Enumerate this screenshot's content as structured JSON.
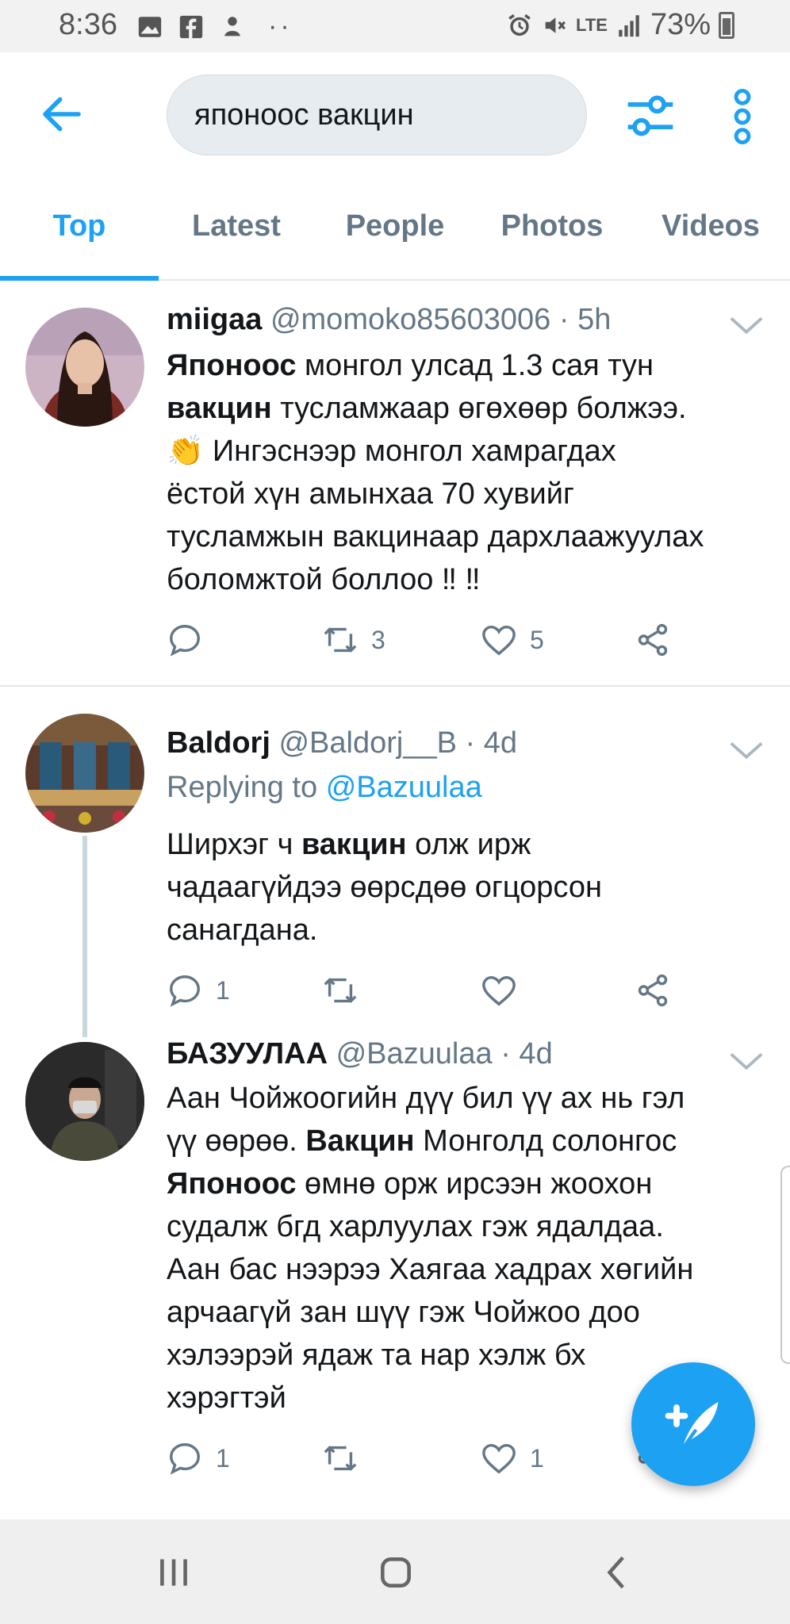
{
  "status_bar": {
    "time": "8:36",
    "network": "LTE",
    "battery": "73%"
  },
  "search": {
    "query": "японоос вакцин"
  },
  "tabs": [
    {
      "label": "Top",
      "active": true
    },
    {
      "label": "Latest"
    },
    {
      "label": "People"
    },
    {
      "label": "Photos"
    },
    {
      "label": "Videos"
    }
  ],
  "tweets": [
    {
      "name": "miigaa",
      "handle": "@momoko85603006",
      "time": "· 5h",
      "body_lines": [
        [
          "Японоос",
          " монгол улсад 1.3 сая тун"
        ],
        [
          "вакцин",
          " тусламжаар өгөхөөр болжээ."
        ],
        [
          "",
          "👏 Ингэснээр монгол  хамрагдах"
        ],
        [
          "",
          "ёстой хүн амынхаа 70 хувийг"
        ],
        [
          "",
          "тусламжын вакцинаар дархлаажуулах"
        ],
        [
          "",
          "боломжтой боллоо ‼ ‼"
        ]
      ],
      "reply_count": "",
      "retweet_count": "3",
      "like_count": "5"
    },
    {
      "name": "Baldorj",
      "handle": "@Baldorj__B",
      "time": "· 4d",
      "replying_label": "Replying to",
      "replying_handle": "@Bazuulaa",
      "body_lines": [
        [
          "Ширхэг ч ",
          "вакцин",
          " олж ирж"
        ],
        [
          "чадаагүйдээ өөрсдөө огцорсон"
        ],
        [
          "санагдана."
        ]
      ],
      "reply_count": "1",
      "retweet_count": "",
      "like_count": ""
    },
    {
      "name": "БАЗУУЛАА",
      "handle": "@Bazuulaa",
      "time": "· 4d",
      "body_lines": [
        [
          "Аан Чойжоогийн дүү бил үү ах нь  гэл"
        ],
        [
          "үү өөрөө. ",
          "Вакцин",
          " Монголд солонгос"
        ],
        [
          "Японоос",
          " өмнө орж ирсээн жоохон"
        ],
        [
          "судалж бгд харлуулах гэж ядалдаа."
        ],
        [
          "Аан бас нээрээ Хаягаа хадрах хөгийн"
        ],
        [
          "арчаагүй зан шүү гэж Чойжоо доо"
        ],
        [
          "хэлээрэй ядаж та нар хэлж бх"
        ],
        [
          "хэрэгтэй"
        ]
      ],
      "reply_count": "1",
      "retweet_count": "",
      "like_count": "1"
    }
  ],
  "colors": {
    "accent": "#1da1f2",
    "muted": "#657786",
    "text": "#14171a"
  }
}
